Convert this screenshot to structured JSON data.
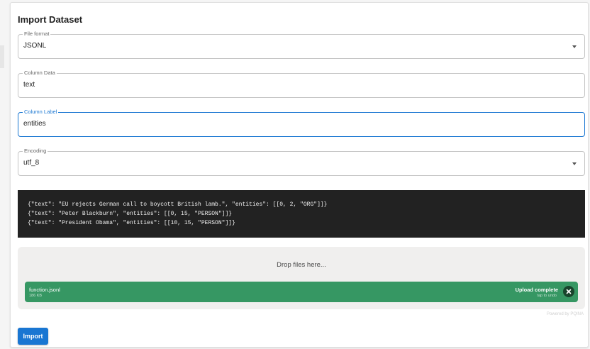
{
  "dialog": {
    "title": "Import Dataset"
  },
  "fields": {
    "file_format": {
      "label": "File format",
      "value": "JSONL"
    },
    "column_data": {
      "label": "Column Data",
      "value": "text"
    },
    "column_label": {
      "label": "Column Label",
      "value": "entities"
    },
    "encoding": {
      "label": "Encoding",
      "value": "utf_8"
    }
  },
  "example": {
    "lines": [
      "{\"text\": \"EU rejects German call to boycott British lamb.\", \"entities\": [[0, 2, \"ORG\"]]}",
      "{\"text\": \"Peter Blackburn\", \"entities\": [[0, 15, \"PERSON\"]]}",
      "{\"text\": \"President Obama\", \"entities\": [[10, 15, \"PERSON\"]]}"
    ]
  },
  "upload": {
    "drop_text": "Drop files here...",
    "file": {
      "name": "function.jsonl",
      "size": "186 KB",
      "status": "Upload complete",
      "status_sub": "tap to undo"
    },
    "credit": "Powered by PQINA"
  },
  "actions": {
    "import_label": "Import"
  },
  "colors": {
    "primary": "#1976d2",
    "success": "#369763",
    "code_bg": "#222222"
  }
}
